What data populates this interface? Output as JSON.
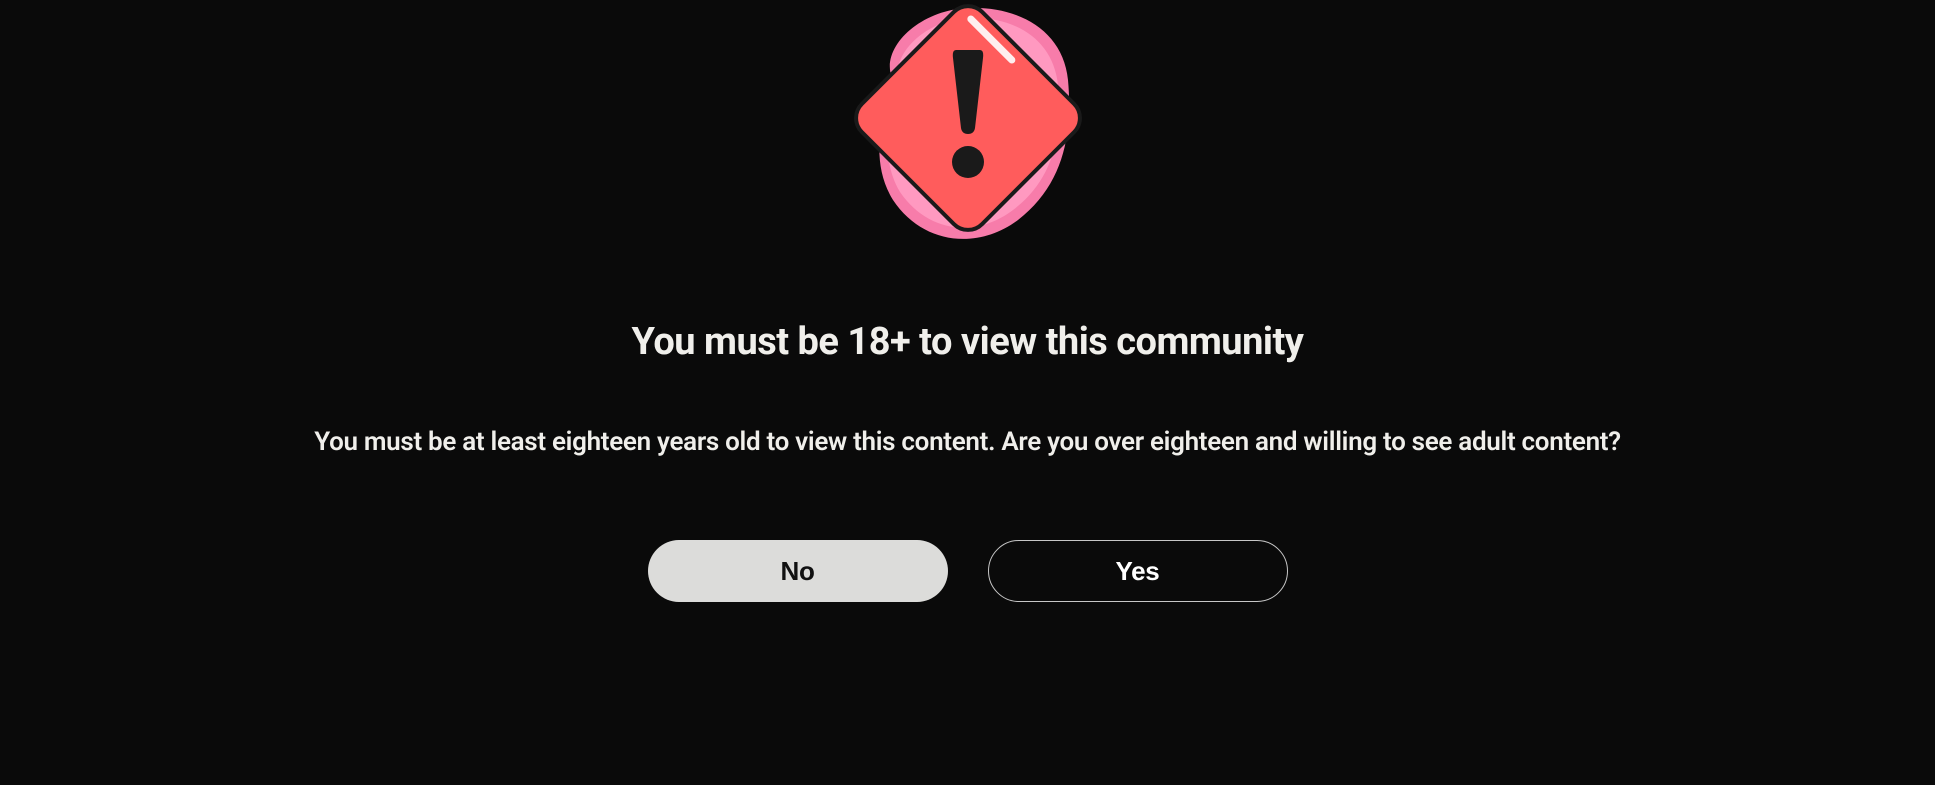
{
  "dialog": {
    "title": "You must be 18+ to view this community",
    "subtitle": "You must be at least eighteen years old to view this content. Are you over eighteen and willing to see adult content?",
    "no_label": "No",
    "yes_label": "Yes"
  }
}
